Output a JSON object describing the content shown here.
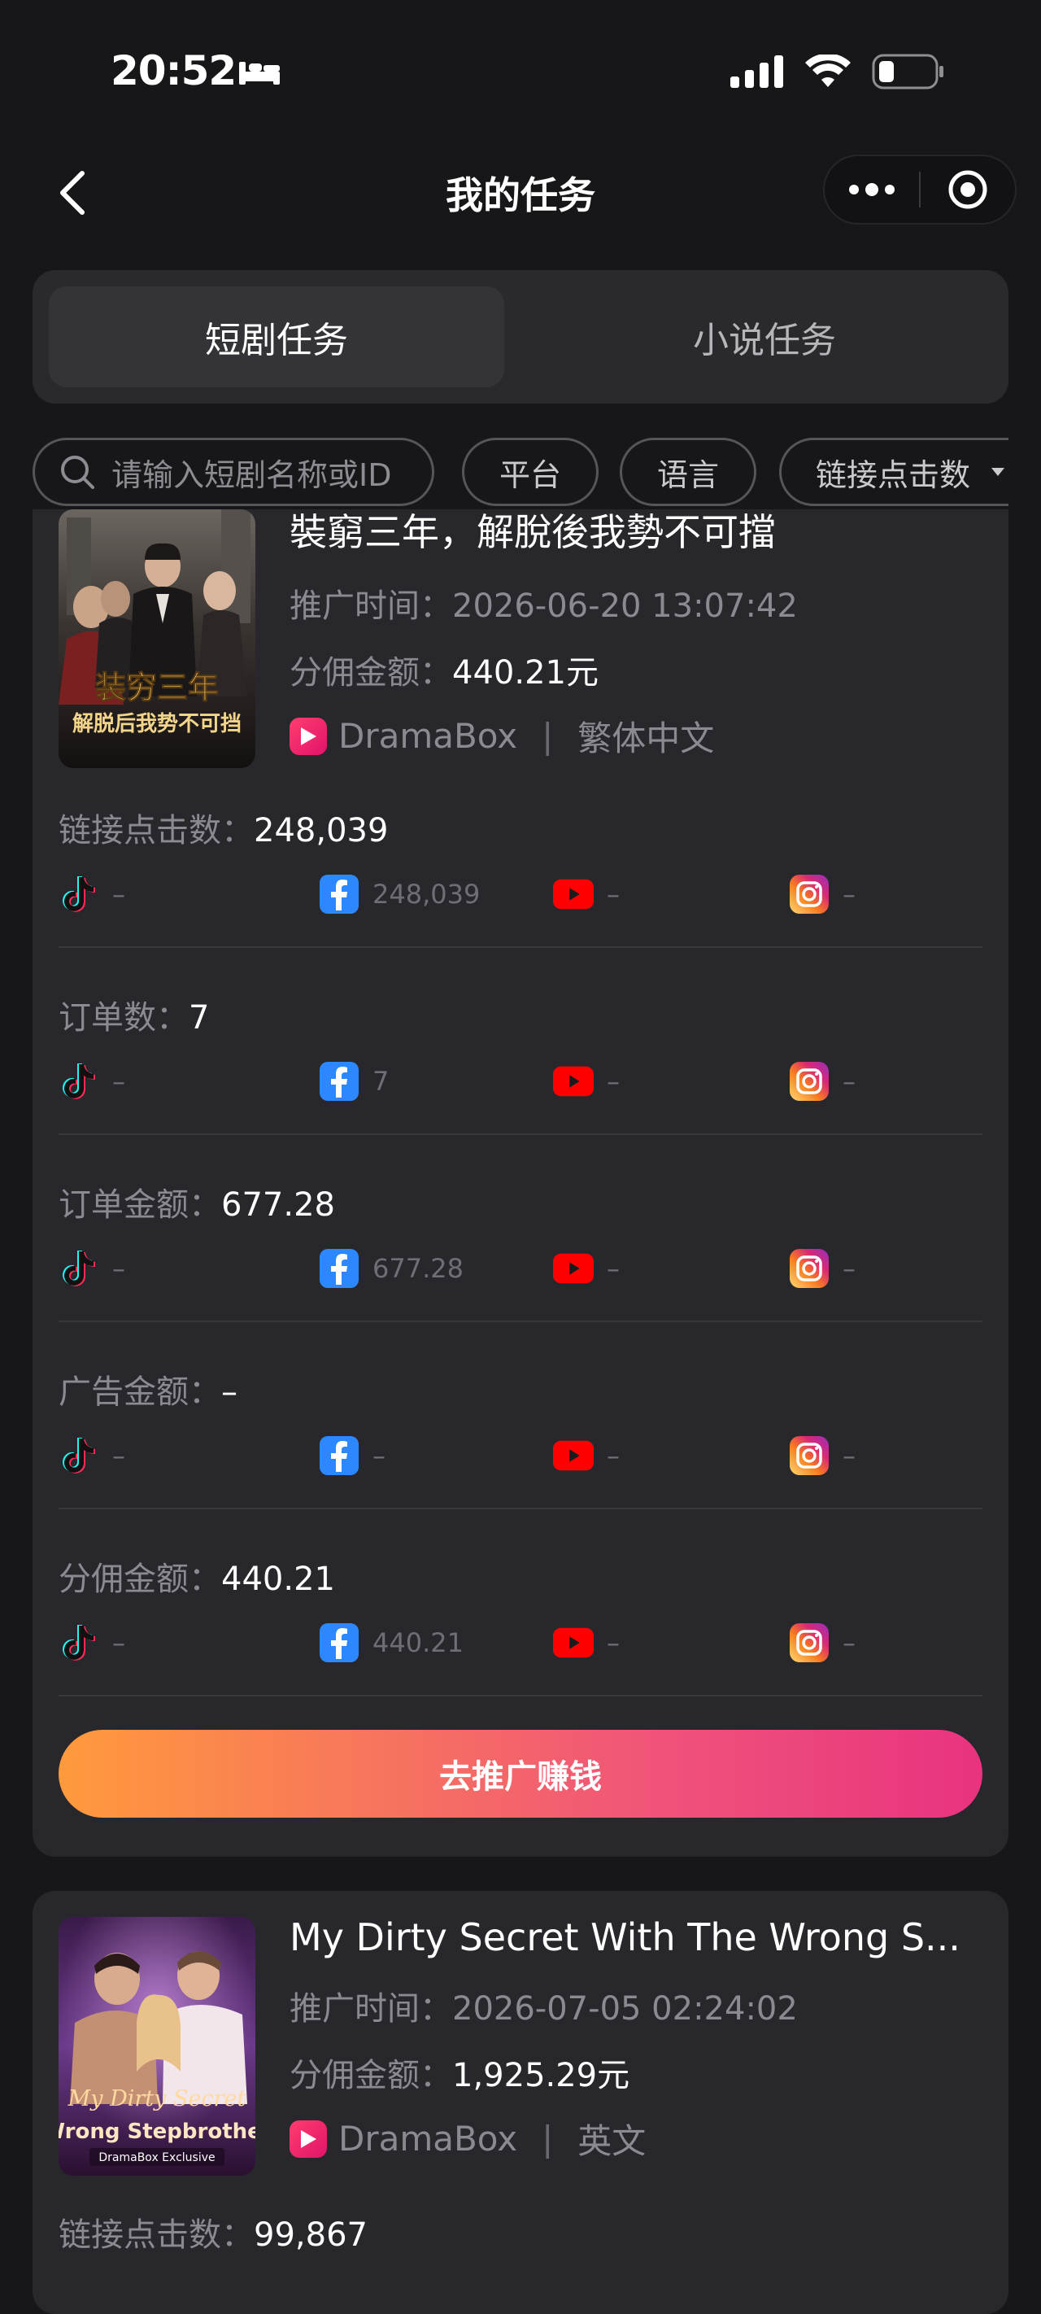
{
  "status_bar": {
    "time": "20:52"
  },
  "nav": {
    "title": "我的任务"
  },
  "tabs": [
    {
      "label": "短剧任务",
      "active": true
    },
    {
      "label": "小说任务",
      "active": false
    }
  ],
  "filters": {
    "search_placeholder": "请输入短剧名称或ID",
    "pills": [
      "平台",
      "语言",
      "链接点击数"
    ]
  },
  "tasks": [
    {
      "title": "裝窮三年，解脫後我勢不可擋",
      "cover_text": [
        "装穷三年",
        "解脱后我势不可挡"
      ],
      "promo_time_label": "推广时间：",
      "promo_time": "2026-06-20 13:07:42",
      "commission_label": "分佣金额：",
      "commission": "440.21元",
      "platform": "DramaBox",
      "language": "繁体中文",
      "metrics": [
        {
          "label": "链接点击数：",
          "value": "248,039",
          "tiktok": "–",
          "facebook": "248,039",
          "youtube": "–",
          "instagram": "–"
        },
        {
          "label": "订单数：",
          "value": "7",
          "tiktok": "–",
          "facebook": "7",
          "youtube": "–",
          "instagram": "–"
        },
        {
          "label": "订单金额：",
          "value": "677.28",
          "tiktok": "–",
          "facebook": "677.28",
          "youtube": "–",
          "instagram": "–"
        },
        {
          "label": "广告金额：",
          "value": "–",
          "tiktok": "–",
          "facebook": "–",
          "youtube": "–",
          "instagram": "–"
        },
        {
          "label": "分佣金额：",
          "value": "440.21",
          "tiktok": "–",
          "facebook": "440.21",
          "youtube": "–",
          "instagram": "–"
        }
      ],
      "cta": "去推广赚钱"
    },
    {
      "title": "My Dirty Secret With The Wrong S...",
      "cover_text": [
        "My Dirty Secret",
        "Wrong Stepbrother",
        "DramaBox Exclusive"
      ],
      "promo_time_label": "推广时间：",
      "promo_time": "2026-07-05 02:24:02",
      "commission_label": "分佣金额：",
      "commission": "1,925.29元",
      "platform": "DramaBox",
      "language": "英文",
      "metrics": [
        {
          "label": "链接点击数：",
          "value": "99,867"
        }
      ]
    }
  ],
  "colors": {
    "accent_start": "#ff9a3c",
    "accent_end": "#e8337f",
    "background": "#17171a",
    "card": "#28282c"
  }
}
